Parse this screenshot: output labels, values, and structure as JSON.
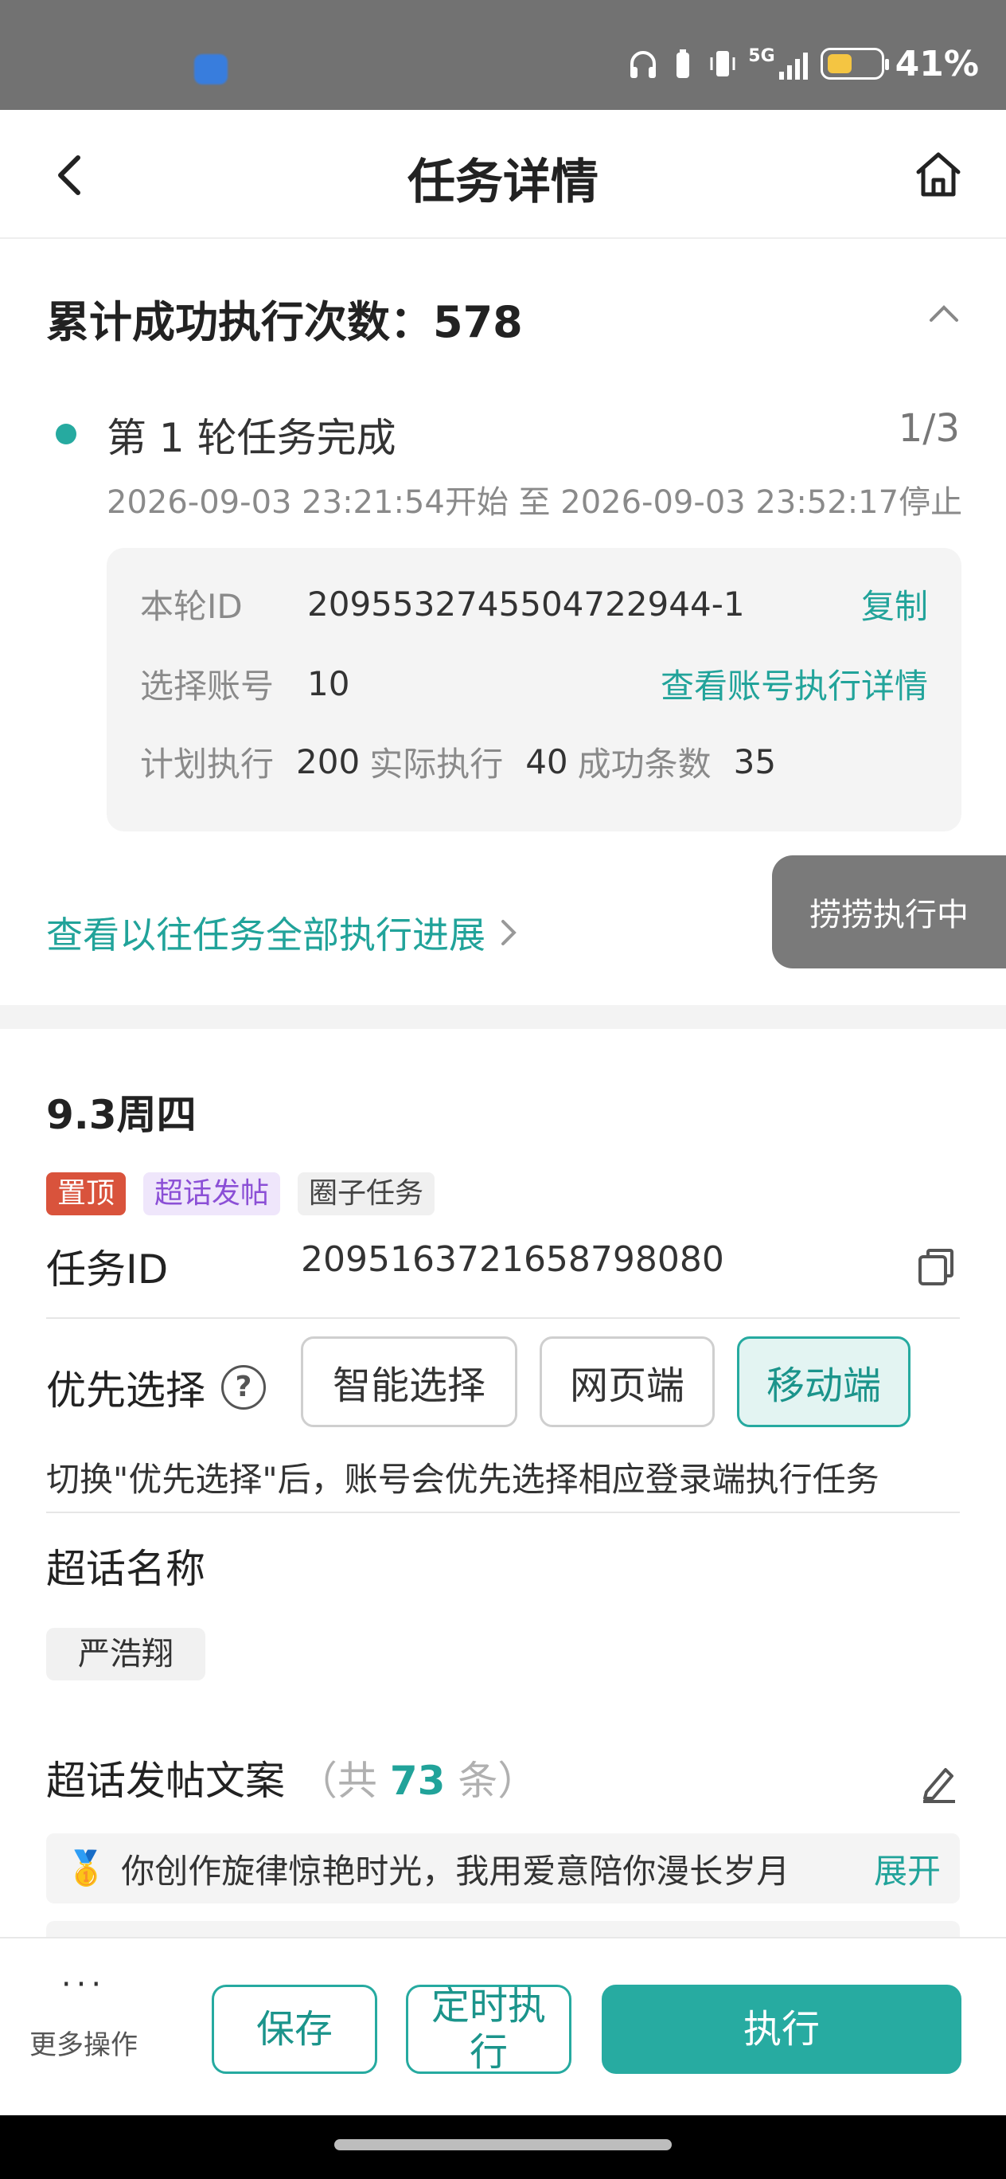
{
  "status_bar": {
    "network": "5G",
    "battery_percent": "41%",
    "battery_level": 0.41,
    "battery_color": "#f4c542"
  },
  "header": {
    "title": "任务详情",
    "back_icon": "chevron-left-icon",
    "home_icon": "home-icon"
  },
  "summary": {
    "cumulative_label": "累计成功执行次数：578",
    "round_title": "第 1 轮任务完成",
    "round_count": "1/3",
    "round_time": "2026-09-03 23:21:54开始 至 2026-09-03 23:52:17停止",
    "round_id_label": "本轮ID",
    "round_id_value": "2095532745504722944-1",
    "copy_link": "复制",
    "accounts_label": "选择账号",
    "accounts_value": "10",
    "accounts_detail_link": "查看账号执行详情",
    "planned_label": "计划执行",
    "planned_value": "200",
    "actual_label": "实际执行",
    "actual_value": "40",
    "success_label": "成功条数",
    "success_value": "35",
    "past_link": "查看以往任务全部执行进展",
    "floating_button": "捞捞执行中"
  },
  "task": {
    "date": "9.3周四",
    "tags": [
      "置顶",
      "超话发帖",
      "圈子任务"
    ],
    "task_id_label": "任务ID",
    "task_id_value": "2095163721658798080",
    "priority_label": "优先选择",
    "priority_options": [
      "智能选择",
      "网页端",
      "移动端"
    ],
    "priority_selected": "移动端",
    "priority_hint": "切换\"优先选择\"后，账号会优先选择相应登录端执行任务",
    "topic_label": "超话名称",
    "topic_value": "严浩翔",
    "copy_label": "超话发帖文案",
    "copy_count_prefix": "（共",
    "copy_count": "73",
    "copy_count_suffix": "条）",
    "copy_item_emoji": "🥇",
    "copy_item_text": "你创作旋律惊艳时光，我用爱意陪你漫长岁月",
    "copy_item_expand": "展开"
  },
  "bottom_bar": {
    "more_label": "更多操作",
    "save": "保存",
    "schedule": "定时执行",
    "execute": "执行"
  },
  "colors": {
    "accent": "#27aba1",
    "tag_top": "#d9533c",
    "tag_post": "#8b4fd6"
  }
}
